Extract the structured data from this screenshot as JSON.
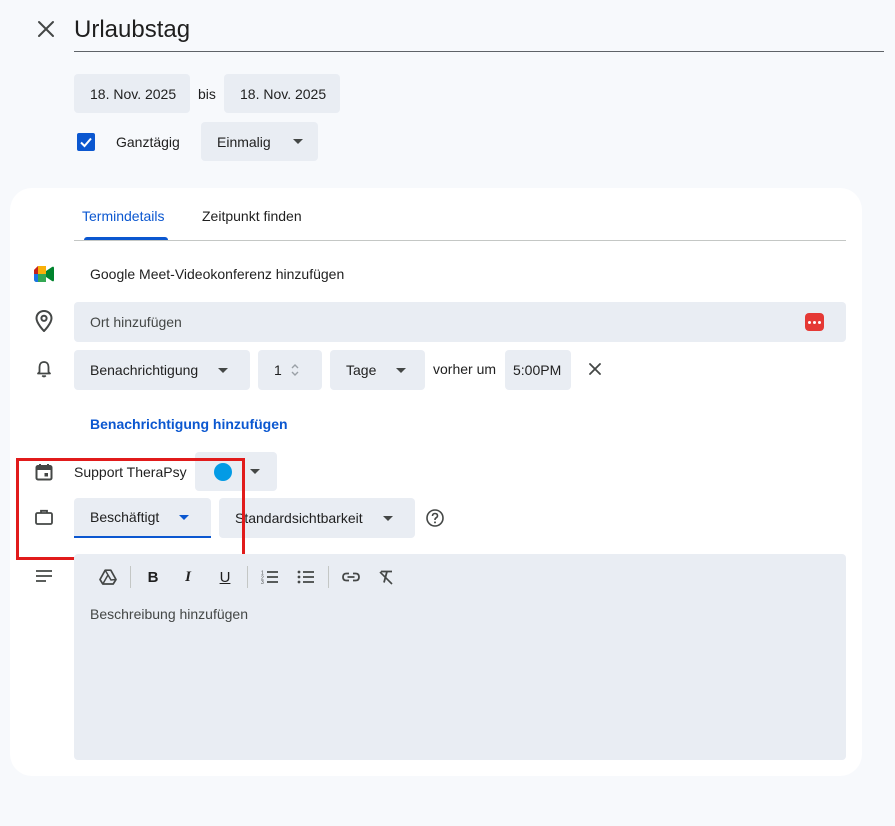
{
  "header": {
    "title": "Urlaubstag"
  },
  "dates": {
    "start": "18. Nov. 2025",
    "separator": "bis",
    "end": "18. Nov. 2025"
  },
  "options": {
    "all_day_label": "Ganztägig",
    "all_day_checked": true,
    "repeat": "Einmalig"
  },
  "tabs": [
    {
      "label": "Termindetails",
      "active": true
    },
    {
      "label": "Zeitpunkt finden",
      "active": false
    }
  ],
  "details": {
    "meet_label": "Google Meet-Videokonferenz hinzufügen",
    "location_placeholder": "Ort hinzufügen",
    "notification": {
      "type": "Benachrichtigung",
      "amount": "1",
      "unit": "Tage",
      "before_label": "vorher um",
      "time": "5:00PM"
    },
    "add_notification": "Benachrichtigung hinzufügen",
    "calendar": {
      "name": "Support TheraPsy",
      "color": "#039be5"
    },
    "availability": "Beschäftigt",
    "visibility": "Standardsichtbarkeit",
    "description_placeholder": "Beschreibung hinzufügen"
  },
  "colors": {
    "accent": "#0b57d0",
    "chip_bg": "#e9edf3",
    "highlight": "#e11b1b"
  },
  "icons": [
    "close-icon",
    "meet-icon",
    "location-pin-icon",
    "bell-icon",
    "calendar-icon",
    "briefcase-icon",
    "notes-icon",
    "help-icon"
  ]
}
